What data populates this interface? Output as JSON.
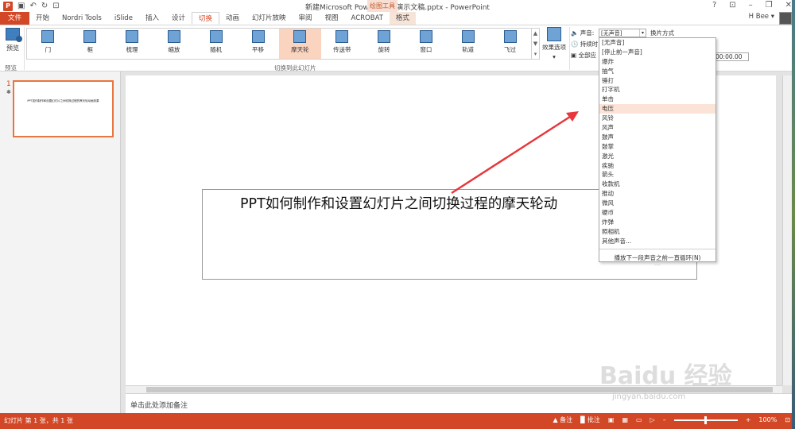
{
  "window": {
    "title": "新建Microsoft PowerPoint 演示文稿.pptx - PowerPoint",
    "contextual_tab_group": "绘图工具",
    "buttons": [
      "?",
      "⊡",
      "–",
      "❐",
      "✕"
    ]
  },
  "quick_access": [
    "↶",
    "↻",
    "⊡"
  ],
  "tabs": [
    {
      "label": "文件",
      "kind": "file"
    },
    {
      "label": "开始",
      "kind": "normal"
    },
    {
      "label": "Nordri Tools",
      "kind": "normal"
    },
    {
      "label": "iSlide",
      "kind": "normal"
    },
    {
      "label": "插入",
      "kind": "normal"
    },
    {
      "label": "设计",
      "kind": "normal"
    },
    {
      "label": "切换",
      "kind": "active"
    },
    {
      "label": "动画",
      "kind": "normal"
    },
    {
      "label": "幻灯片放映",
      "kind": "normal"
    },
    {
      "label": "审阅",
      "kind": "normal"
    },
    {
      "label": "视图",
      "kind": "normal"
    },
    {
      "label": "ACROBAT",
      "kind": "normal"
    },
    {
      "label": "格式",
      "kind": "format"
    }
  ],
  "user": {
    "name": "H⁠ Bee ▾"
  },
  "ribbon": {
    "preview_label": "预览",
    "preview_group": "预览",
    "transitions_group": "切换到此幻灯片",
    "effects": [
      {
        "label": "门",
        "icon": "door-transition-icon",
        "selected": false
      },
      {
        "label": "框",
        "icon": "box-transition-icon",
        "selected": false
      },
      {
        "label": "梳理",
        "icon": "comb-transition-icon",
        "selected": false
      },
      {
        "label": "缩放",
        "icon": "zoom-transition-icon",
        "selected": false
      },
      {
        "label": "随机",
        "icon": "random-transition-icon",
        "selected": false
      },
      {
        "label": "平移",
        "icon": "pan-transition-icon",
        "selected": false
      },
      {
        "label": "摩天轮",
        "icon": "ferris-wheel-transition-icon",
        "selected": true
      },
      {
        "label": "传送带",
        "icon": "conveyor-transition-icon",
        "selected": false
      },
      {
        "label": "旋转",
        "icon": "rotate-transition-icon",
        "selected": false
      },
      {
        "label": "窗口",
        "icon": "window-transition-icon",
        "selected": false
      },
      {
        "label": "轨道",
        "icon": "orbit-transition-icon",
        "selected": false
      },
      {
        "label": "飞过",
        "icon": "fly-through-transition-icon",
        "selected": false
      }
    ],
    "effect_options_label": "效果选项",
    "sound_label": "声音:",
    "sound_value": "[无声音]",
    "advance_label": "换片方式",
    "duration_label": "持续时",
    "apply_all_label": "全部应",
    "time_value": "00:00.00"
  },
  "sound_dropdown": {
    "items": [
      "[无声音]",
      "[停止前一声音]",
      "爆炸",
      "抽气",
      "锤打",
      "打字机",
      "单击",
      "电压",
      "风铃",
      "风声",
      "鼓声",
      "鼓掌",
      "激光",
      "疾驰",
      "箭头",
      "收款机",
      "推动",
      "微风",
      "硬币",
      "炸弹",
      "照相机",
      "其他声音..."
    ],
    "highlighted": "电压",
    "loop_label": "播放下一段声音之前一直循环(N)"
  },
  "slides": [
    {
      "number": "1",
      "title": "PPT如何制作和设置幻灯片之间切换过程的摩天轮动画效果"
    }
  ],
  "slide_title_visible": "PPT如何制作和设置幻灯片之间切换过程的摩天轮动",
  "notes_placeholder": "单击此处添加备注",
  "status": {
    "slide_info": "幻灯片 第 1 张，共 1 张",
    "notes_label": "备注",
    "comments_label": "批注",
    "zoom": "100%",
    "zoom_level": 0.5
  },
  "watermark": {
    "brand": "Baidu 经验",
    "url": "jingyan.baidu.com"
  }
}
